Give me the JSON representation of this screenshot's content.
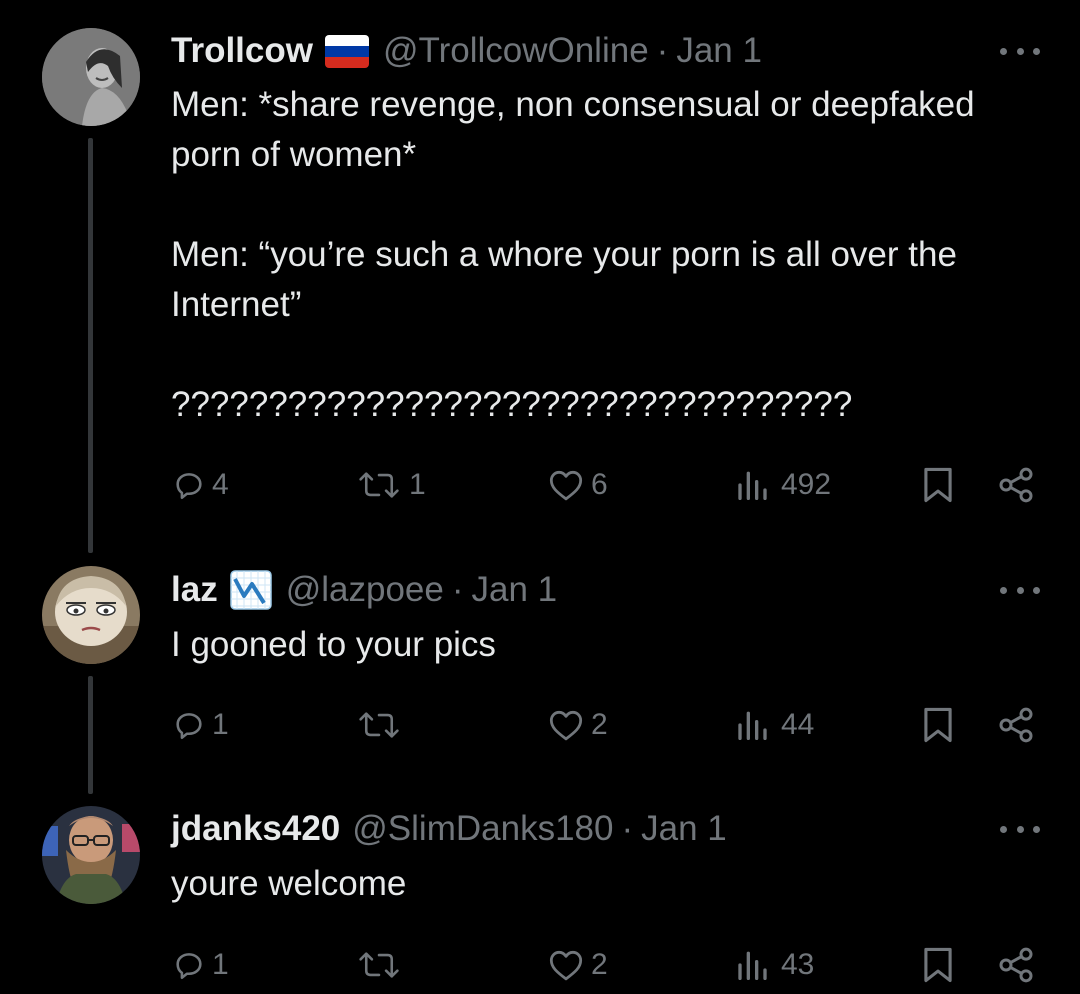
{
  "icons": {
    "flag": "russia-flag",
    "badge": "chart-decreasing-emoji",
    "more": "ellipsis-icon",
    "reply": "reply-icon",
    "retweet": "retweet-icon",
    "like": "heart-icon",
    "views": "views-icon",
    "bookmark": "bookmark-icon",
    "share": "share-icon"
  },
  "colors": {
    "background": "#000000",
    "text": "#e7e9ea",
    "secondary": "#71767b",
    "thread_line": "#333639"
  },
  "tweets": [
    {
      "name": "Trollcow",
      "handle": "@TrollcowOnline",
      "dot": "·",
      "date": "Jan 1",
      "text": "Men: *share revenge, non consensual or deepfaked porn of women*\n\nMen: “you’re such a whore your porn is all over the Internet”\n\n???????????????????????????????????",
      "replies": "4",
      "retweets": "1",
      "likes": "6",
      "views": "492"
    },
    {
      "name": "laz",
      "handle": "@lazpoee",
      "dot": "·",
      "date": "Jan 1",
      "text": "I gooned to your pics",
      "replies": "1",
      "retweets": "",
      "likes": "2",
      "views": "44"
    },
    {
      "name": "jdanks420",
      "handle": "@SlimDanks180",
      "dot": "·",
      "date": "Jan 1",
      "text": "youre welcome",
      "replies": "1",
      "retweets": "",
      "likes": "2",
      "views": "43"
    }
  ]
}
